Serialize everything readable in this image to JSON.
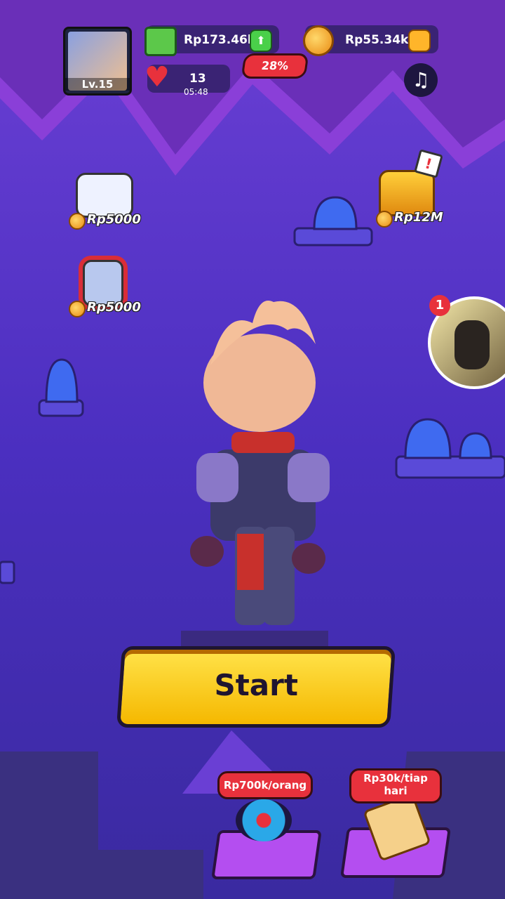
{
  "player": {
    "level": "Lv.15"
  },
  "currency": {
    "cash": "Rp173.46k",
    "coins": "Rp55.34k",
    "boost_percent": "28%"
  },
  "lives": {
    "count": "13",
    "timer": "05:48"
  },
  "rewards": {
    "game_reward": "Rp5000",
    "fist_reward": "Rp5000",
    "chest_reward": "Rp12M"
  },
  "notifications": {
    "avatar_badge": "1"
  },
  "start_button": {
    "label": "Start"
  },
  "bottom": {
    "invite_label": "Rp700k/orang",
    "daily_label": "Rp30k/tiap hari"
  },
  "colors": {
    "background": "#4a2fb0",
    "start_yellow": "#ffd21a",
    "tag_red": "#e8313c"
  }
}
